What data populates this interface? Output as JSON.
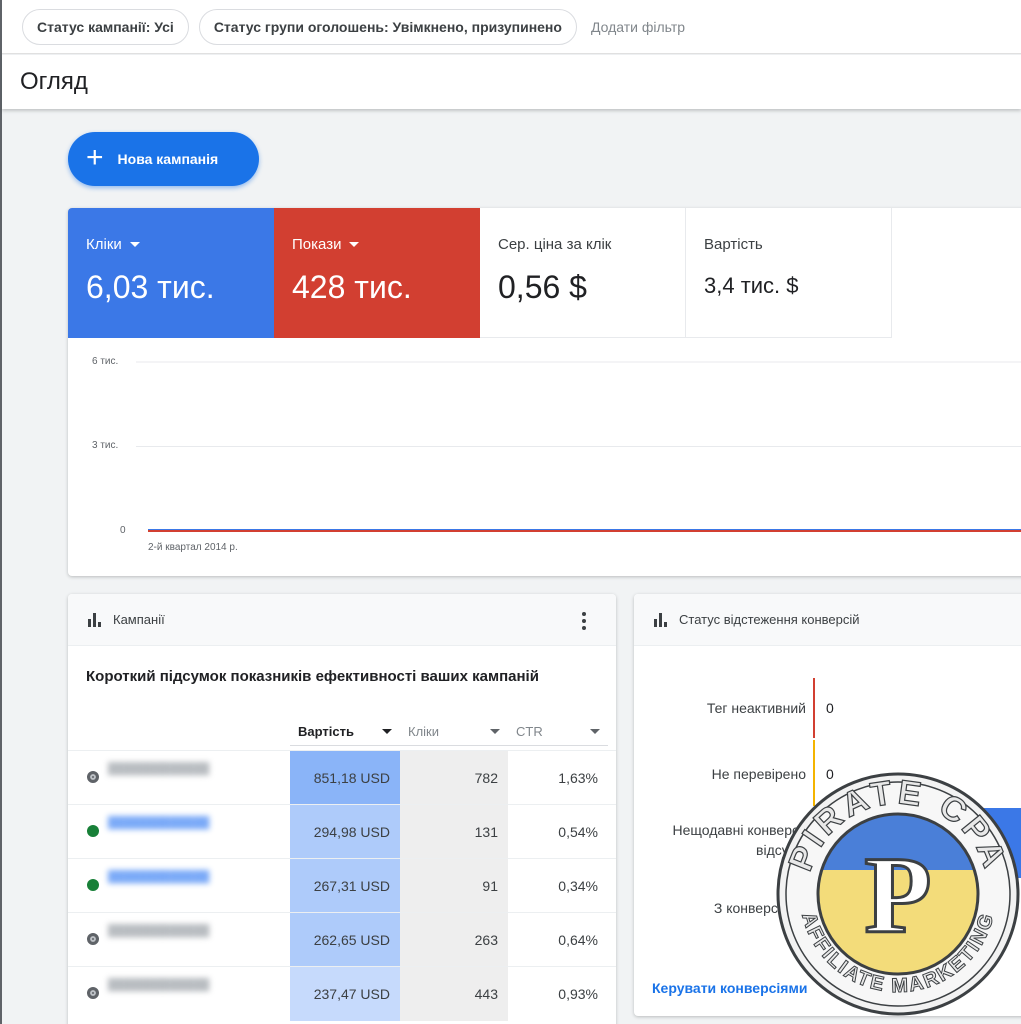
{
  "filters": {
    "campaign_status": "Статус кампанії: Усі",
    "ad_group_status": "Статус групи оголошень: Увімкнено, призупинено",
    "add_filter": "Додати фільтр"
  },
  "page": {
    "title": "Огляд"
  },
  "new_campaign": {
    "label": "Нова кампанія",
    "icon": "plus-icon"
  },
  "metrics": [
    {
      "label": "Кліки",
      "value": "6,03 тис.",
      "color": "#3b78e7",
      "dropdown": true
    },
    {
      "label": "Покази",
      "value": "428 тис.",
      "color": "#d23f31",
      "dropdown": true
    },
    {
      "label": "Сер. ціна за клік",
      "value": "0,56 $",
      "dropdown": false
    },
    {
      "label": "Вартість",
      "value": "3,4 тис. $",
      "dropdown": false
    }
  ],
  "chart_data": {
    "type": "line",
    "x": [
      "2-й квартал 2014 р."
    ],
    "yticks": [
      "6 тис.",
      "3 тис.",
      "0"
    ],
    "ylim": [
      0,
      6000
    ],
    "series": [
      {
        "color": "#3b78e7",
        "values": [
          0
        ]
      },
      {
        "color": "#d23f31",
        "values": [
          0
        ]
      }
    ],
    "grid": true
  },
  "campaigns_card": {
    "title": "Кампанії",
    "subtitle": "Короткий підсумок показників ефективності ваших кампаній",
    "columns": [
      "Вартість",
      "Кліки",
      "CTR"
    ],
    "rows": [
      {
        "status": "gray",
        "cost": "851,18 USD",
        "clicks": "782",
        "ctr": "1,63%"
      },
      {
        "status": "green",
        "cost": "294,98 USD",
        "clicks": "131",
        "ctr": "0,54%"
      },
      {
        "status": "green",
        "cost": "267,31 USD",
        "clicks": "91",
        "ctr": "0,34%"
      },
      {
        "status": "gray",
        "cost": "262,65 USD",
        "clicks": "263",
        "ctr": "0,64%"
      },
      {
        "status": "gray",
        "cost": "237,47 USD",
        "clicks": "443",
        "ctr": "0,93%"
      }
    ]
  },
  "conversions_card": {
    "title": "Статус відстеження конверсій",
    "rows": [
      {
        "label": "Тег неактивний",
        "value": "0",
        "color": "#d23f31"
      },
      {
        "label": "Не перевірено",
        "value": "0",
        "color": "#f4b400"
      },
      {
        "label": "Нещодавні конверсії відсутні",
        "value": "",
        "color": "#3b78e7"
      },
      {
        "label": "З конверсіями",
        "value": "0",
        "color": "#188038"
      }
    ],
    "manage_link": "Керувати конверсіями"
  },
  "watermark": {
    "top": "PIRATE CPA",
    "letter": "P",
    "bottom": "AFFILIATE MARKETING"
  }
}
